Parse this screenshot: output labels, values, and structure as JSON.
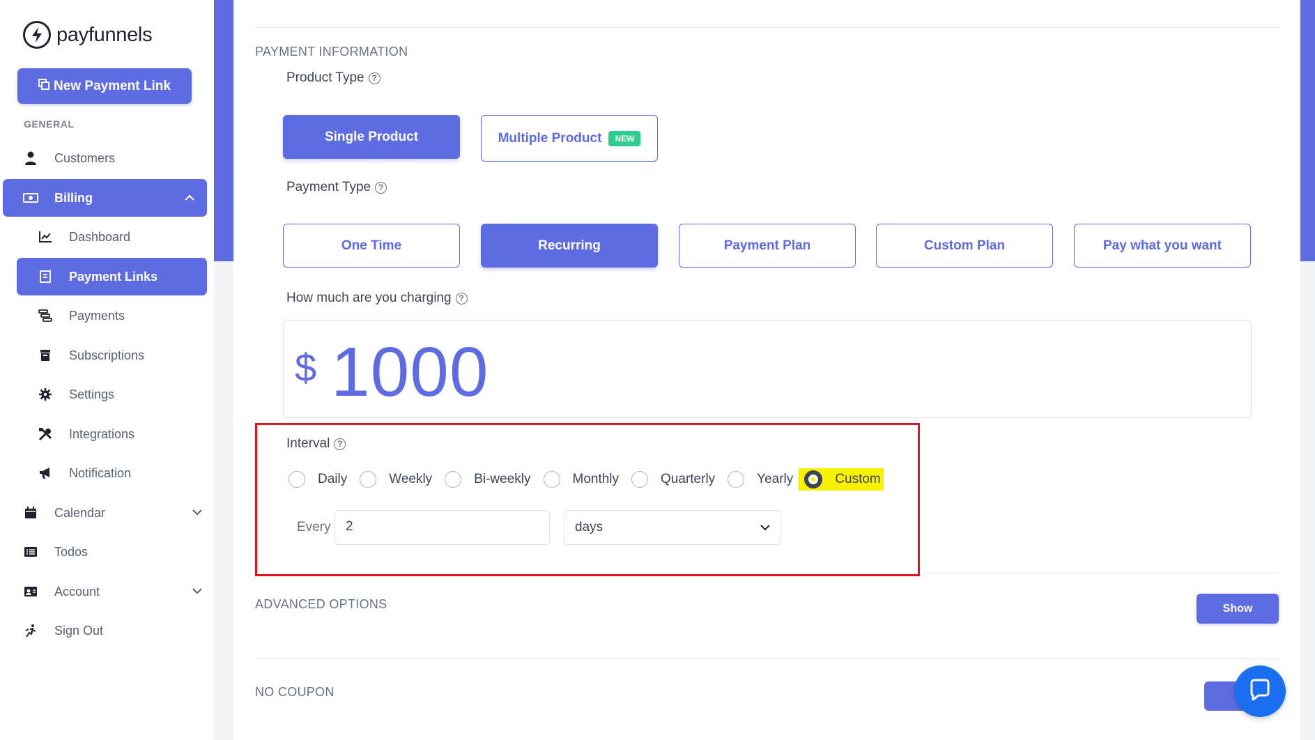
{
  "brand": {
    "name": "payfunnels",
    "accent": "#5e6ce3"
  },
  "sidebar": {
    "new_link_label": "New Payment Link",
    "section_label": "GENERAL",
    "items": [
      {
        "label": "Customers",
        "icon": "user-icon"
      },
      {
        "label": "Billing",
        "icon": "money-icon",
        "active": true,
        "expanded": true
      },
      {
        "label": "Dashboard",
        "icon": "chart-icon",
        "sub": true
      },
      {
        "label": "Payment Links",
        "icon": "link-icon",
        "sub": true,
        "active": true
      },
      {
        "label": "Payments",
        "icon": "coins-icon",
        "sub": true
      },
      {
        "label": "Subscriptions",
        "icon": "box-icon",
        "sub": true
      },
      {
        "label": "Settings",
        "icon": "gear-icon",
        "sub": true
      },
      {
        "label": "Integrations",
        "icon": "tools-icon",
        "sub": true
      },
      {
        "label": "Notification",
        "icon": "megaphone-icon",
        "sub": true
      },
      {
        "label": "Calendar",
        "icon": "calendar-icon"
      },
      {
        "label": "Todos",
        "icon": "list-icon"
      },
      {
        "label": "Account",
        "icon": "id-card-icon"
      },
      {
        "label": "Sign Out",
        "icon": "run-icon"
      }
    ]
  },
  "payment_info": {
    "section_title": "PAYMENT INFORMATION",
    "product_type_label": "Product Type",
    "product_types": [
      {
        "label": "Single Product",
        "selected": true
      },
      {
        "label": "Multiple Product",
        "badge": "NEW",
        "selected": false
      }
    ],
    "payment_type_label": "Payment Type",
    "payment_types": [
      {
        "label": "One Time",
        "selected": false
      },
      {
        "label": "Recurring",
        "selected": true
      },
      {
        "label": "Payment Plan",
        "selected": false
      },
      {
        "label": "Custom Plan",
        "selected": false
      },
      {
        "label": "Pay what you want",
        "selected": false
      }
    ],
    "charging_label": "How much are you charging",
    "currency_symbol": "$",
    "amount": "1000"
  },
  "interval": {
    "label": "Interval",
    "options": [
      "Daily",
      "Weekly",
      "Bi-weekly",
      "Monthly",
      "Quarterly",
      "Yearly",
      "Custom"
    ],
    "selected": "Custom",
    "every_label": "Every",
    "every_value": "2",
    "unit_value": "days"
  },
  "advanced": {
    "title": "ADVANCED OPTIONS",
    "button_label": "Show"
  },
  "coupon": {
    "title": "NO COUPON"
  }
}
